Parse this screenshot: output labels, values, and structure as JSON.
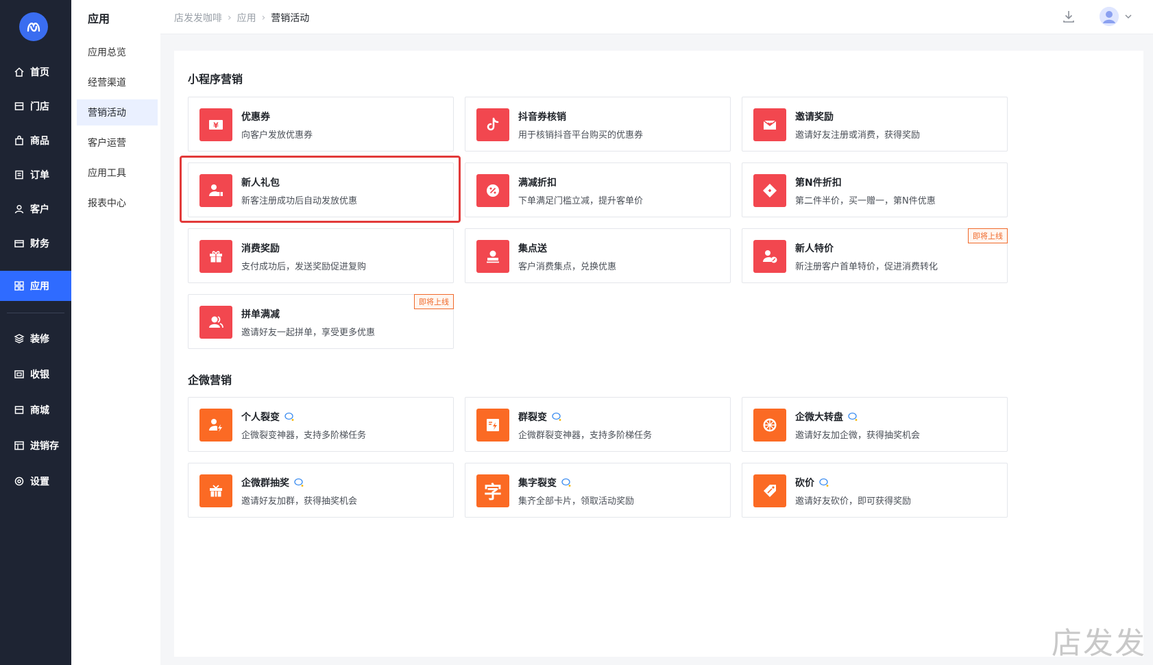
{
  "nav": {
    "items": [
      {
        "label": "首页",
        "icon": "home-icon"
      },
      {
        "label": "门店",
        "icon": "store-icon"
      },
      {
        "label": "商品",
        "icon": "bag-icon"
      },
      {
        "label": "订单",
        "icon": "order-icon"
      },
      {
        "label": "客户",
        "icon": "user-icon"
      },
      {
        "label": "财务",
        "icon": "wallet-icon"
      },
      {
        "label": "应用",
        "icon": "apps-icon"
      },
      {
        "label": "装修",
        "icon": "layers-icon"
      },
      {
        "label": "收银",
        "icon": "cashier-icon"
      },
      {
        "label": "商城",
        "icon": "mall-icon"
      },
      {
        "label": "进销存",
        "icon": "inventory-icon"
      },
      {
        "label": "设置",
        "icon": "settings-icon"
      }
    ],
    "active": "应用"
  },
  "submenu": {
    "title": "应用",
    "items": [
      "应用总览",
      "经营渠道",
      "营销活动",
      "客户运营",
      "应用工具",
      "报表中心"
    ],
    "active": "营销活动"
  },
  "breadcrumb": {
    "items": [
      "店发发咖啡",
      "应用",
      "营销活动"
    ]
  },
  "sections": [
    {
      "title": "小程序营销",
      "cards": [
        {
          "title": "优惠券",
          "desc": "向客户发放优惠券",
          "icon": "coupon-icon",
          "color": "#f2474f"
        },
        {
          "title": "抖音券核销",
          "desc": "用于核销抖音平台购买的优惠券",
          "icon": "douyin-icon",
          "color": "#f2474f"
        },
        {
          "title": "邀请奖励",
          "desc": "邀请好友注册或消费，获得奖励",
          "icon": "invite-envelope-icon",
          "color": "#f2474f"
        },
        {
          "title": "新人礼包",
          "desc": "新客注册成功后自动发放优惠",
          "icon": "new-user-gift-icon",
          "color": "#f2474f"
        },
        {
          "title": "满减折扣",
          "desc": "下单满足门槛立减，提升客单价",
          "icon": "percent-icon",
          "color": "#f2474f"
        },
        {
          "title": "第N件折扣",
          "desc": "第二件半价，买一赠一，第N件优惠",
          "icon": "tag-icon",
          "color": "#f2474f"
        },
        {
          "title": "消费奖励",
          "desc": "支付成功后，发送奖励促进复购",
          "icon": "gift-icon",
          "color": "#f2474f"
        },
        {
          "title": "集点送",
          "desc": "客户消费集点，兑换优惠",
          "icon": "stamp-icon",
          "color": "#f2474f"
        },
        {
          "title": "新人特价",
          "desc": "新注册客户首单特价，促进消费转化",
          "icon": "new-user-price-icon",
          "color": "#f2474f",
          "badge": "即将上线"
        },
        {
          "title": "拼单满减",
          "desc": "邀请好友一起拼单，享受更多优惠",
          "icon": "group-users-icon",
          "color": "#f2474f",
          "badge": "即将上线"
        }
      ]
    },
    {
      "title": "企微营销",
      "cards": [
        {
          "title": "个人裂变",
          "desc": "企微裂变神器，支持多阶梯任务",
          "icon": "user-bolt-icon",
          "color": "#fb6a24",
          "wecom": true
        },
        {
          "title": "群裂变",
          "desc": "企微群裂变神器，支持多阶梯任务",
          "icon": "group-bolt-icon",
          "color": "#fb6a24",
          "wecom": true
        },
        {
          "title": "企微大转盘",
          "desc": "邀请好友加企微，获得抽奖机会",
          "icon": "wheel-icon",
          "color": "#fb6a24",
          "wecom": true
        },
        {
          "title": "企微群抽奖",
          "desc": "邀请好友加群，获得抽奖机会",
          "icon": "lottery-gift-icon",
          "color": "#fb6a24",
          "wecom": true
        },
        {
          "title": "集字裂变",
          "desc": "集齐全部卡片，领取活动奖励",
          "icon": "character-icon",
          "color": "#fb6a24",
          "wecom": true,
          "glyph": "字"
        },
        {
          "title": "砍价",
          "desc": "邀请好友砍价，即可获得奖励",
          "icon": "bargain-tag-icon",
          "color": "#fb6a24",
          "wecom": true
        }
      ]
    }
  ],
  "watermark": "店发发"
}
